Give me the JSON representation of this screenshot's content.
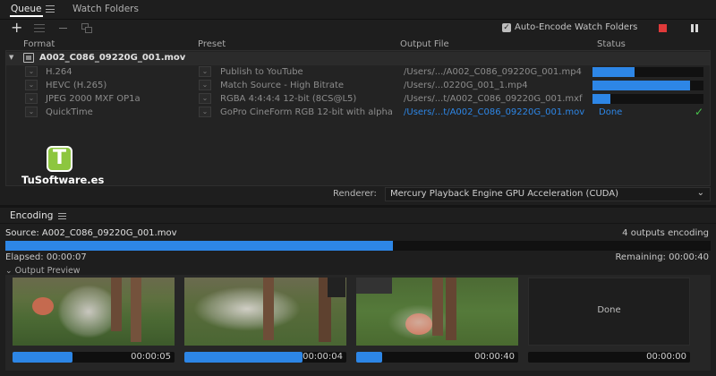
{
  "tabs": {
    "queue": "Queue",
    "watch": "Watch Folders"
  },
  "toolbar": {
    "auto_encode": "Auto-Encode Watch Folders"
  },
  "columns": {
    "format": "Format",
    "preset": "Preset",
    "output": "Output File",
    "status": "Status"
  },
  "source_item": {
    "name": "A002_C086_09220G_001.mov"
  },
  "rows": [
    {
      "format": "H.264",
      "preset": "Publish to YouTube",
      "output": "/Users/.../A002_C086_09220G_001.mp4",
      "progress": 0.38,
      "status": ""
    },
    {
      "format": "HEVC (H.265)",
      "preset": "Match Source - High Bitrate",
      "output": "/Users/...0220G_001_1.mp4",
      "progress": 0.88,
      "status": ""
    },
    {
      "format": "JPEG 2000 MXF OP1a",
      "preset": "RGBA 4:4:4:4 12-bit (8CS@L5)",
      "output": "/Users/...t/A002_C086_09220G_001.mxf",
      "progress": 0.16,
      "status": ""
    },
    {
      "format": "QuickTime",
      "preset": "GoPro CineForm RGB 12-bit with alpha",
      "output": "/Users/...t/A002_C086_09220G_001.mov",
      "progress": 1.0,
      "status": "Done"
    }
  ],
  "logo": {
    "letter": "T",
    "text": "TuSoftware.es"
  },
  "renderer": {
    "label": "Renderer:",
    "value": "Mercury Playback Engine GPU Acceleration (CUDA)"
  },
  "encoding": {
    "title": "Encoding",
    "source_label": "Source: A002_C086_09220G_001.mov",
    "outputs_status": "4 outputs encoding",
    "progress": 0.55,
    "elapsed": "Elapsed: 00:00:07",
    "remaining": "Remaining: 00:00:40",
    "preview_label": "Output Preview"
  },
  "previews": [
    {
      "time": "00:00:05",
      "progress": 0.37
    },
    {
      "time": "00:00:04",
      "progress": 0.73
    },
    {
      "time": "00:00:40",
      "progress": 0.16
    },
    {
      "time": "00:00:00",
      "progress": 0,
      "done_label": "Done"
    }
  ],
  "colors": {
    "accent": "#2d86e6",
    "done": "#2d86e6",
    "check": "#47c24a",
    "stop": "#e03a3a",
    "logo_bg": "#8dc63f"
  }
}
